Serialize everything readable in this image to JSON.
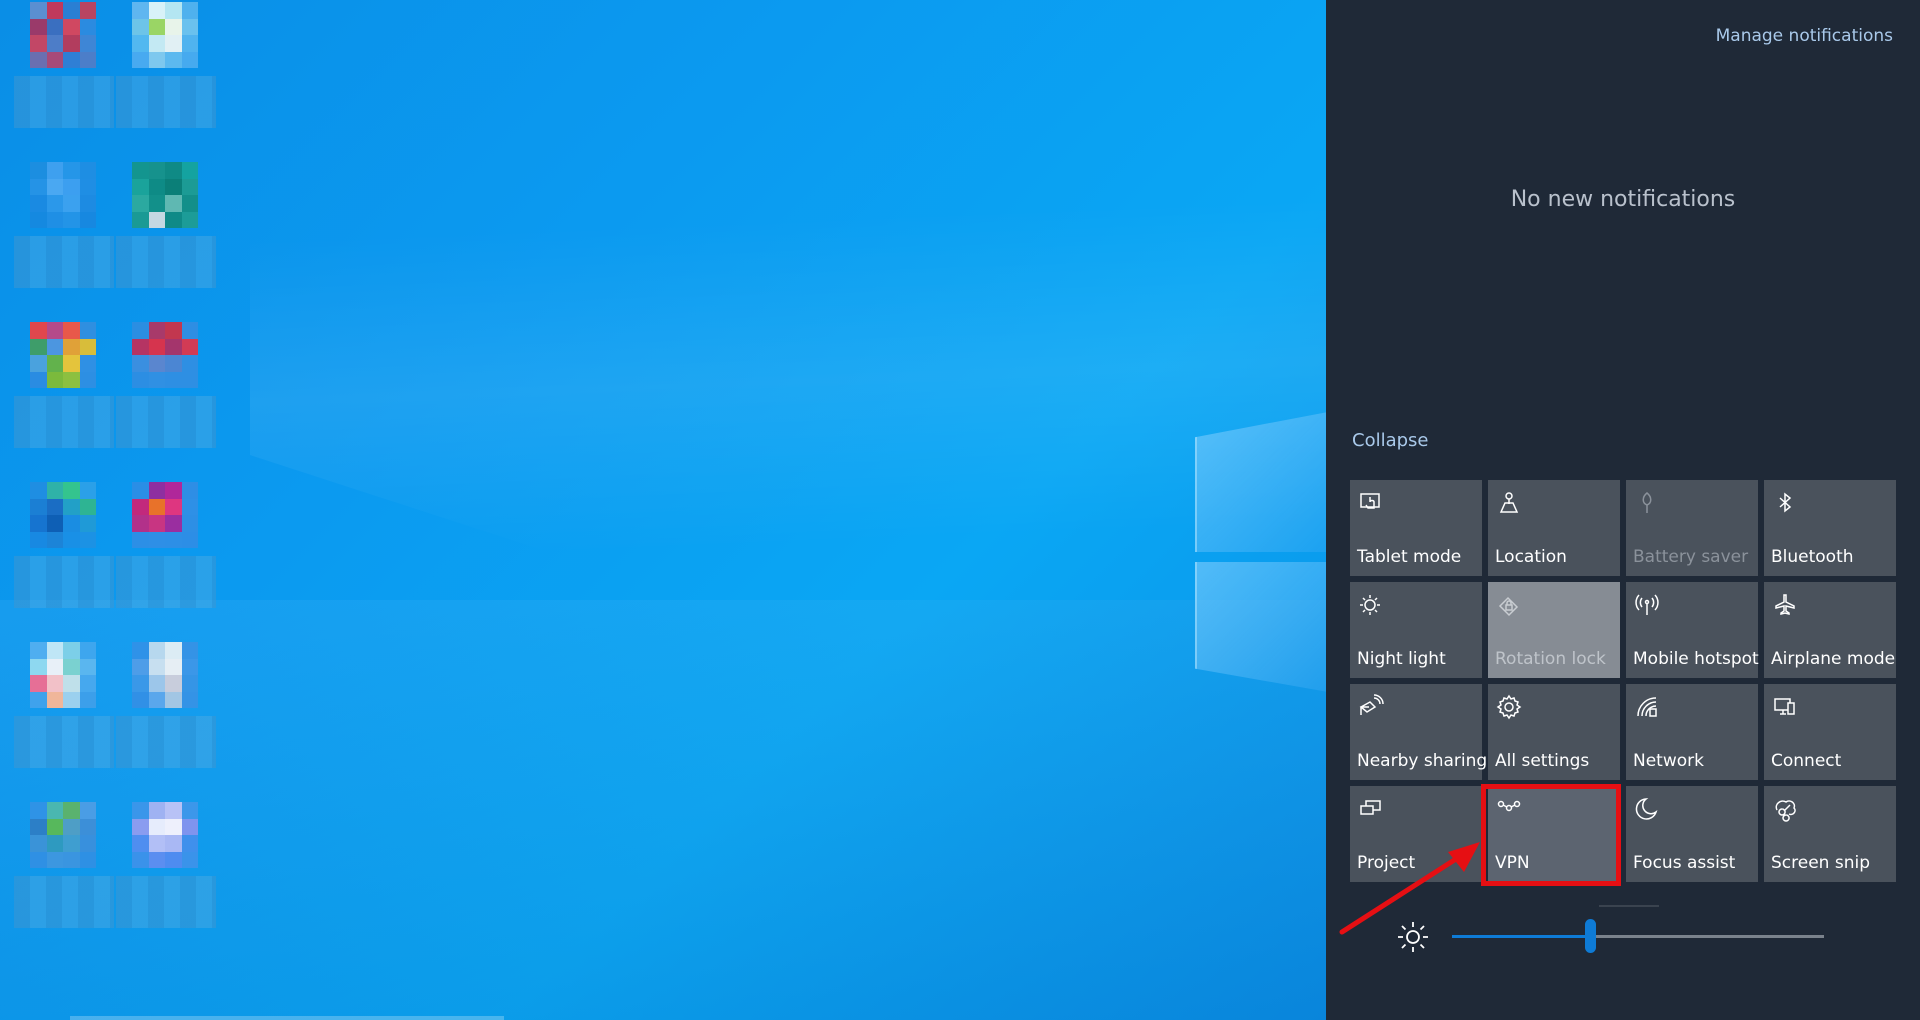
{
  "action_center": {
    "manage_notifications": "Manage notifications",
    "no_notifications": "No new notifications",
    "collapse": "Collapse",
    "tiles": [
      {
        "label": "Tablet mode",
        "icon": "tablet-mode-icon",
        "state": "off"
      },
      {
        "label": "Location",
        "icon": "location-icon",
        "state": "off"
      },
      {
        "label": "Battery saver",
        "icon": "battery-saver-icon",
        "state": "disabled"
      },
      {
        "label": "Bluetooth",
        "icon": "bluetooth-icon",
        "state": "off"
      },
      {
        "label": "Night light",
        "icon": "night-light-icon",
        "state": "off"
      },
      {
        "label": "Rotation lock",
        "icon": "rotation-lock-icon",
        "state": "on-disabled"
      },
      {
        "label": "Mobile hotspot",
        "icon": "mobile-hotspot-icon",
        "state": "off"
      },
      {
        "label": "Airplane mode",
        "icon": "airplane-icon",
        "state": "off"
      },
      {
        "label": "Nearby sharing",
        "icon": "nearby-sharing-icon",
        "state": "off"
      },
      {
        "label": "All settings",
        "icon": "gear-icon",
        "state": "off"
      },
      {
        "label": "Network",
        "icon": "network-icon",
        "state": "off"
      },
      {
        "label": "Connect",
        "icon": "connect-icon",
        "state": "off"
      },
      {
        "label": "Project",
        "icon": "project-icon",
        "state": "off"
      },
      {
        "label": "VPN",
        "icon": "vpn-icon",
        "state": "highlighted"
      },
      {
        "label": "Focus assist",
        "icon": "moon-icon",
        "state": "off"
      },
      {
        "label": "Screen snip",
        "icon": "screen-snip-icon",
        "state": "off"
      }
    ],
    "brightness": {
      "icon": "brightness-sun-icon",
      "value_fraction": 0.37
    }
  },
  "annotation": {
    "highlight_color": "#e60f13",
    "arrow_color": "#e60f13",
    "target": "VPN"
  },
  "colors": {
    "panel_bg": "#1f2937",
    "tile_bg": "#4a525c",
    "accent": "#0e7bd6",
    "link": "#a9c9ea"
  },
  "desktop": {
    "icons": [
      {
        "colors": [
          "#5a8fd1",
          "#c0395c",
          "#2a7fd3",
          "#b84461",
          "#9a3a6a",
          "#3a6fc0",
          "#d04861",
          "#2b8be0",
          "#c24766",
          "#4d7dc8",
          "#b23d5e",
          "#3e86d6",
          "#6a6fb0",
          "#a74a78",
          "#2f7fd5",
          "#4c7ec9"
        ]
      },
      {
        "colors": [
          "#5fb6f0",
          "#d8f2f8",
          "#b4e6f2",
          "#4fb1ee",
          "#6dc4e8",
          "#9ad565",
          "#e8f4ea",
          "#6ac1ee",
          "#52b8f0",
          "#c3e9f3",
          "#e1f0f4",
          "#50b3ef",
          "#48aaf0",
          "#7ec8ee",
          "#5cb9ef",
          "#46aaef"
        ]
      },
      {
        "colors": [
          "#1c8ee0",
          "#3ea0ef",
          "#2596e8",
          "#1e8ee3",
          "#2593e6",
          "#4aa8f2",
          "#3c9ff0",
          "#1f8ee4",
          "#1a8ae2",
          "#2b98ea",
          "#3ba1ef",
          "#1d8be2",
          "#1589e0",
          "#1f8fe5",
          "#2394e7",
          "#1788e0"
        ]
      },
      {
        "colors": [
          "#13958f",
          "#16928d",
          "#0f8a85",
          "#14a3a0",
          "#1aa39b",
          "#0e8b86",
          "#0b7f78",
          "#1c9b95",
          "#2ba9a0",
          "#12908a",
          "#5fb8b2",
          "#138f8a",
          "#1a9a95",
          "#c5d8e2",
          "#0f8a87",
          "#1c9c98"
        ]
      },
      {
        "colors": [
          "#e0474d",
          "#b54a8a",
          "#e8584a",
          "#2f8fe0",
          "#3e9d6a",
          "#4c96e0",
          "#e0a138",
          "#d8bd3a",
          "#4aa2de",
          "#62b24c",
          "#e4c43c",
          "#2f90e4",
          "#2a8ce2",
          "#7bba3c",
          "#8cc040",
          "#2d8fe3"
        ]
      },
      {
        "colors": [
          "#2b8ee2",
          "#a83a6a",
          "#c2374f",
          "#2e8ee3",
          "#b53463",
          "#d6344e",
          "#a4356c",
          "#d23b55",
          "#3a8fe0",
          "#5a86cf",
          "#4b86d3",
          "#2e8fe3",
          "#2c8ee3",
          "#3090e3",
          "#2e8fe3",
          "#2e8fe3"
        ]
      },
      {
        "colors": [
          "#1f8ee2",
          "#2fb2a8",
          "#34c48e",
          "#2ba0e8",
          "#1b7fd4",
          "#1a6dc4",
          "#22a0c7",
          "#2eb493",
          "#1674d0",
          "#0e5fb5",
          "#1a8de2",
          "#1f9ad7",
          "#1889e2",
          "#1c84d8",
          "#1990e6",
          "#1c92e4"
        ]
      },
      {
        "colors": [
          "#2a8ee6",
          "#8e2fa0",
          "#b0279a",
          "#2e8ee5",
          "#c2297c",
          "#e8722a",
          "#de3680",
          "#2e90e6",
          "#b2318a",
          "#c83582",
          "#9a2ea0",
          "#2d8fe5",
          "#2c8fe6",
          "#2e8fe6",
          "#2d8fe6",
          "#2c8ee6"
        ]
      },
      {
        "colors": [
          "#4faef0",
          "#bfe6f6",
          "#7ccfe8",
          "#3ea6ee",
          "#8ed8f0",
          "#e8f0f8",
          "#7ad1d0",
          "#5ab6ef",
          "#e66f96",
          "#f2c1c8",
          "#bfe0ea",
          "#46a8ee",
          "#3fa2ec",
          "#f0b69a",
          "#9bd0ee",
          "#3c9fea"
        ]
      },
      {
        "colors": [
          "#2f92e8",
          "#b7d8ee",
          "#dcecf4",
          "#3493e6",
          "#4e9de8",
          "#c7dff0",
          "#e6eef4",
          "#3b97e8",
          "#3a98e8",
          "#9cc6ea",
          "#c8cddc",
          "#3595e6",
          "#3190e6",
          "#5aa7ec",
          "#a2c6e4",
          "#3493e6"
        ]
      },
      {
        "colors": [
          "#2f93e6",
          "#4ab7b0",
          "#5ab26e",
          "#4a9de5",
          "#2c7fc7",
          "#57b85c",
          "#4e9ec6",
          "#3c8fd8",
          "#3a93d8",
          "#2e9ac0",
          "#3f9ed0",
          "#3890dd",
          "#2f90e4",
          "#3c97e0",
          "#3a95e0",
          "#2e90e4"
        ]
      },
      {
        "colors": [
          "#3a96ea",
          "#9fb2f2",
          "#b8c2f6",
          "#3c97ea",
          "#8a9cf0",
          "#e6ecfc",
          "#eef0fc",
          "#7f94ee",
          "#4f8ef0",
          "#b2bff6",
          "#a9b8f4",
          "#3f90ec",
          "#3a92ea",
          "#5b8ef0",
          "#4e8cf0",
          "#3a93ea"
        ]
      }
    ]
  }
}
